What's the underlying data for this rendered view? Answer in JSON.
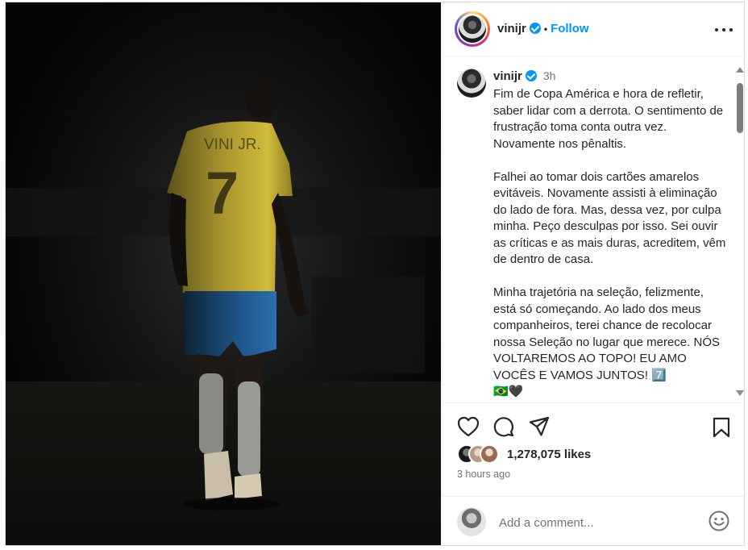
{
  "post": {
    "username": "vinijr",
    "follow_label": "Follow",
    "separator": "•",
    "time": "3h",
    "caption": "Fim de Copa América e hora de refletir, saber lidar com a derrota. O sentimento de frustração toma conta outra vez. Novamente nos pênaltis.\n\nFalhei ao tomar dois cartões amarelos evitáveis. Novamente assisti à eliminação do lado de fora. Mas, dessa vez, por culpa minha. Peço desculpas por isso. Sei ouvir as críticas e as mais duras, acreditem, vêm de dentro de casa.\n\nMinha trajetória na seleção, felizmente, está só começando. Ao lado dos meus companheiros, terei chance de recolocar nossa Seleção no lugar que merece. NÓS VOLTAREMOS AO TOPO! EU AMO VOCÊS E VAMOS JUNTOS! 7️⃣\n🇧🇷🖤",
    "likes": "1,278,075 likes",
    "posted_ago": "3 hours ago",
    "jersey_name": "VINI JR.",
    "jersey_number": "7"
  },
  "comment": {
    "placeholder": "Add a comment..."
  },
  "icons": {
    "like": "heart-icon",
    "comment": "comment-icon",
    "share": "share-icon",
    "save": "bookmark-icon",
    "more": "more-icon",
    "emoji": "emoji-icon",
    "verified": "verified-badge-icon"
  },
  "colors": {
    "accent": "#0095f6",
    "text": "#262626",
    "muted": "#737373",
    "jersey": "#e2c93a",
    "shorts": "#2a6fb0"
  }
}
